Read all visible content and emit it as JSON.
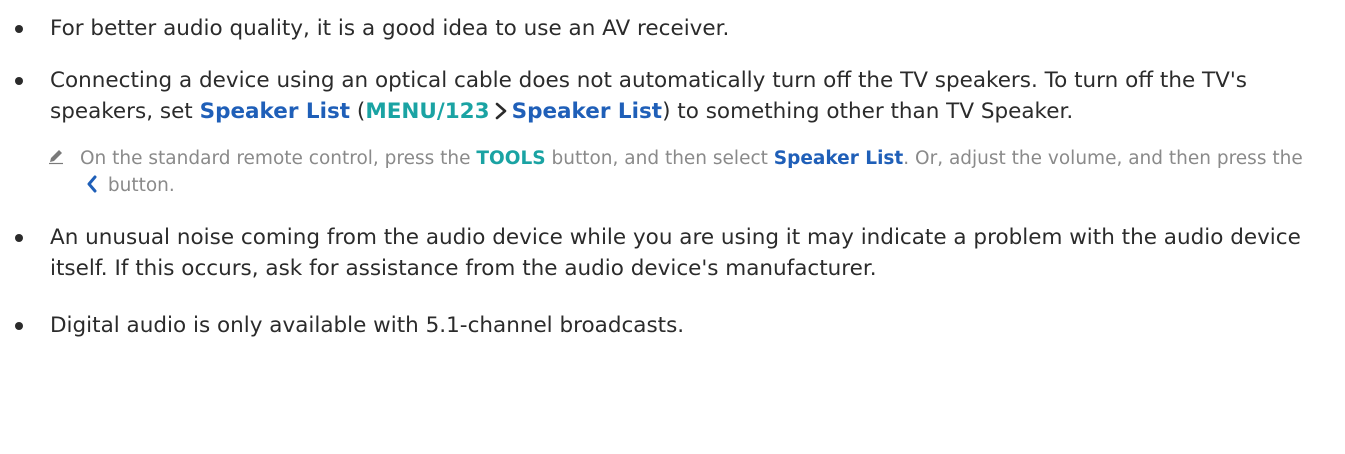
{
  "bullets": {
    "b1": {
      "text": "For better audio quality, it is a good idea to use an AV receiver."
    },
    "b2": {
      "t1": "Connecting a device using an optical cable does not automatically turn off the TV speakers. To turn off the TV's speakers, set ",
      "kw1": "Speaker List",
      "t2": " (",
      "menu": "MENU/123",
      "kw2": "Speaker List",
      "t3": ") to something other than TV Speaker."
    },
    "note": {
      "t1": "On the standard remote control, press the ",
      "tools": "TOOLS",
      "t2": " button, and then select ",
      "kw": "Speaker List",
      "t3": ". Or, adjust the volume, and then press the",
      "t4": " button."
    },
    "b3": {
      "text": "An unusual noise coming from the audio device while you are using it may indicate a problem with the audio device itself. If this occurs, ask for assistance from the audio device's manufacturer."
    },
    "b4": {
      "text": "Digital audio is only available with 5.1-channel broadcasts."
    }
  },
  "icons": {
    "pencil": "pencil-note-icon",
    "chevron": "chevron-right-icon",
    "back": "chevron-left-icon"
  },
  "colors": {
    "text": "#2b2b2b",
    "keyword": "#1f5fb8",
    "menu": "#1aa3a3",
    "note": "#8a8a8a"
  }
}
